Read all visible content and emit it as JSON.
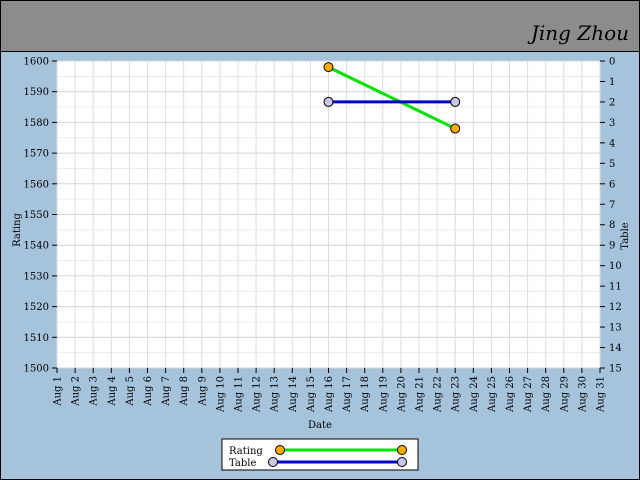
{
  "header": {
    "player_name": "Jing Zhou"
  },
  "chart_data": {
    "type": "line",
    "xlabel": "Date",
    "ylabel_left": "Rating",
    "ylabel_right": "Table",
    "x_categories": [
      "Aug 1",
      "Aug 2",
      "Aug 3",
      "Aug 4",
      "Aug 5",
      "Aug 6",
      "Aug 7",
      "Aug 8",
      "Aug 9",
      "Aug 10",
      "Aug 11",
      "Aug 12",
      "Aug 13",
      "Aug 14",
      "Aug 15",
      "Aug 16",
      "Aug 17",
      "Aug 18",
      "Aug 19",
      "Aug 20",
      "Aug 21",
      "Aug 22",
      "Aug 23",
      "Aug 24",
      "Aug 25",
      "Aug 26",
      "Aug 27",
      "Aug 28",
      "Aug 29",
      "Aug 30",
      "Aug 31"
    ],
    "ylim_left": [
      1500,
      1600
    ],
    "yticks_left": [
      1500,
      1510,
      1520,
      1530,
      1540,
      1550,
      1560,
      1570,
      1580,
      1590,
      1600
    ],
    "ylim_right": [
      0,
      15
    ],
    "yticks_right": [
      0,
      1,
      2,
      3,
      4,
      5,
      6,
      7,
      8,
      9,
      10,
      11,
      12,
      13,
      14,
      15
    ],
    "right_axis_inverted": true,
    "grid": true,
    "legend_position": "bottom-center",
    "series": [
      {
        "name": "Rating",
        "axis": "left",
        "color": "#00e600",
        "marker_color": "#ffaa00",
        "points": [
          {
            "x": "Aug 16",
            "y": 1598
          },
          {
            "x": "Aug 23",
            "y": 1578
          }
        ]
      },
      {
        "name": "Table",
        "axis": "right",
        "color": "#0000cc",
        "marker_color": "#c8c8e6",
        "points": [
          {
            "x": "Aug 16",
            "y": 2
          },
          {
            "x": "Aug 23",
            "y": 2
          }
        ]
      }
    ]
  }
}
